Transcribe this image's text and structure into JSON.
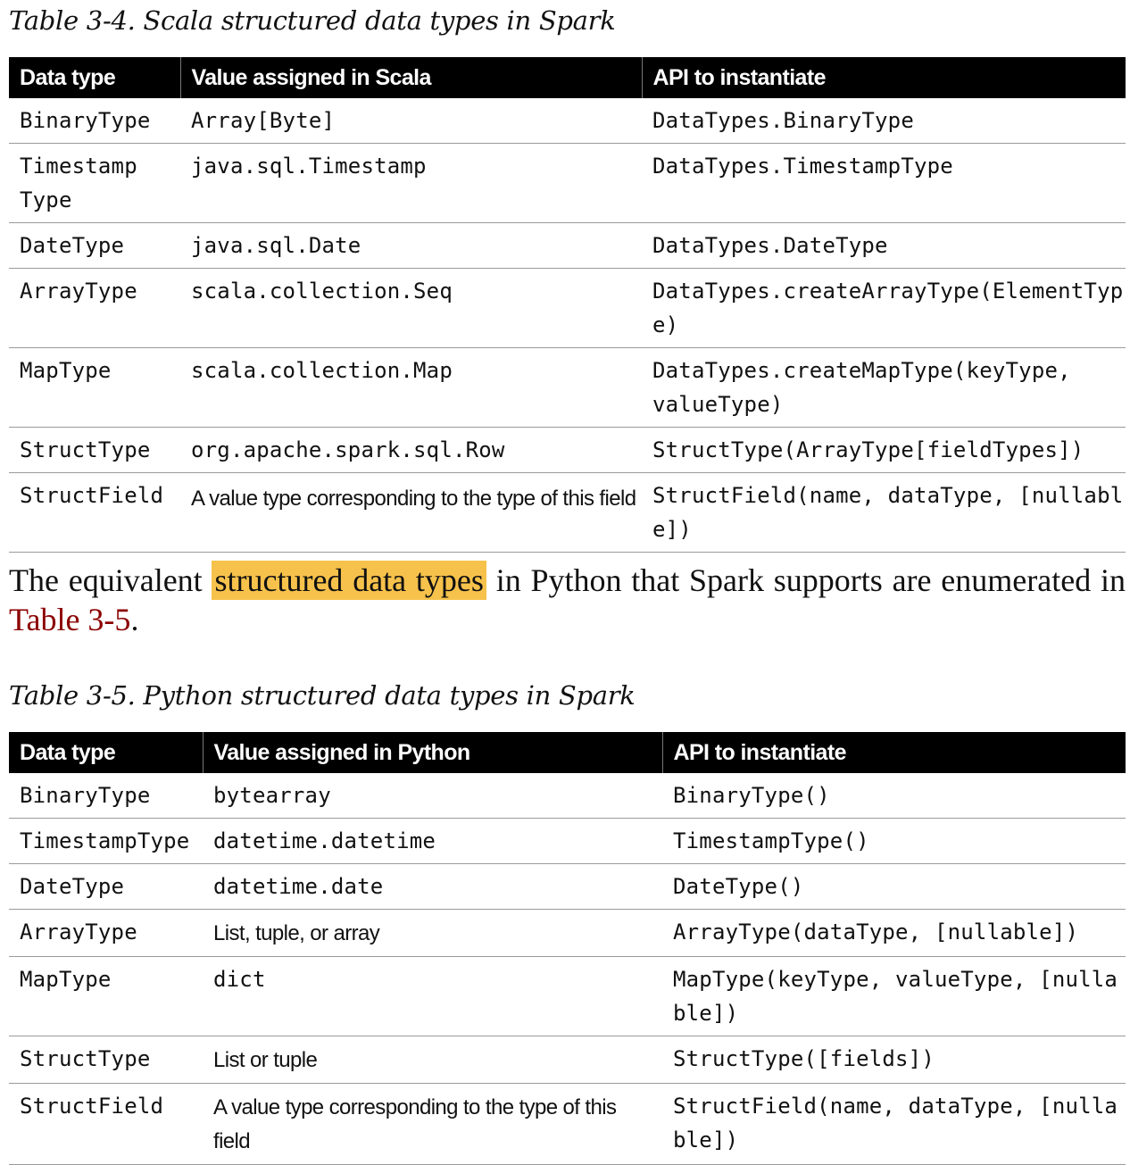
{
  "table1": {
    "caption": "Table 3-4. Scala structured data types in Spark",
    "headers": [
      "Data type",
      "Value assigned in Scala",
      "API to instantiate"
    ],
    "rows": [
      [
        "BinaryType",
        "Array[Byte]",
        "DataTypes.BinaryType"
      ],
      [
        "Timestamp Type",
        "java.sql.Timestamp",
        "DataTypes.TimestampType"
      ],
      [
        "DateType",
        "java.sql.Date",
        "DataTypes.DateType"
      ],
      [
        "ArrayType",
        "scala.collection.Seq",
        "DataTypes.createArrayType(ElementType)"
      ],
      [
        "MapType",
        "scala.collection.Map",
        "DataTypes.createMapType(keyType, valueType)"
      ],
      [
        "StructType",
        "org.apache.spark.sql.Row",
        "StructType(ArrayType[fieldTypes])"
      ],
      [
        "StructField",
        "A value type corresponding to the type of this field",
        "StructField(name, dataType, [nullable])"
      ]
    ]
  },
  "paragraph": {
    "before": "The equivalent ",
    "highlight": "structured data types",
    "middle": " in Python that Spark supports are enumerated in ",
    "link": "Table 3-5",
    "after": ".",
    "highlight_color": "#f7c24b",
    "link_color": "#8b0000"
  },
  "table2": {
    "caption": "Table 3-5. Python structured data types in Spark",
    "headers": [
      "Data type",
      "Value assigned in Python",
      "API to instantiate"
    ],
    "rows": [
      [
        "BinaryType",
        "bytearray",
        "BinaryType()"
      ],
      [
        "TimestampType",
        "datetime.datetime",
        "TimestampType()"
      ],
      [
        "DateType",
        "datetime.date",
        "DateType()"
      ],
      [
        "ArrayType",
        "List, tuple, or array",
        "ArrayType(dataType, [nullable])"
      ],
      [
        "MapType",
        "dict",
        "MapType(keyType, valueType, [nullable])"
      ],
      [
        "StructType",
        "List or tuple",
        "StructType([fields])"
      ],
      [
        "StructField",
        "A value type corresponding to the type of this field",
        "StructField(name, dataType, [nullable])"
      ]
    ]
  }
}
